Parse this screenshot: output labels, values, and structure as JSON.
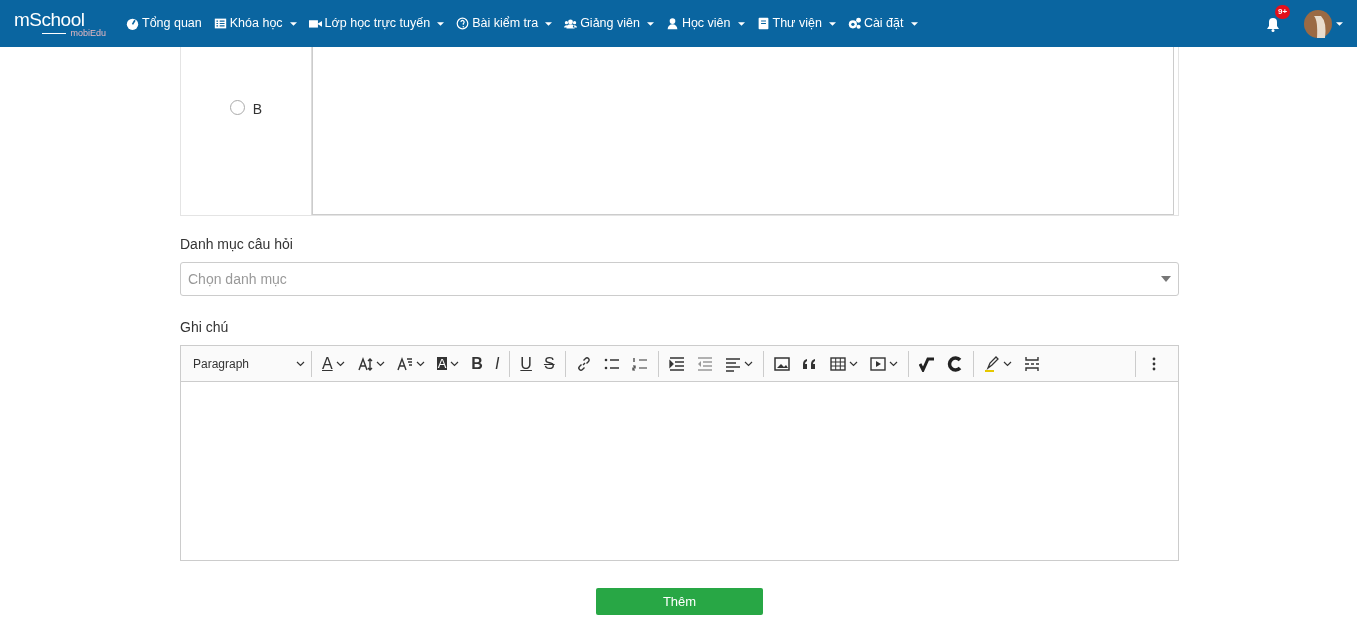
{
  "navbar": {
    "logo": {
      "main": "mSchool",
      "sub": "mobiEdu"
    },
    "items": [
      {
        "kind": "gauge",
        "label": "Tổng quan",
        "dropdown": false
      },
      {
        "kind": "list",
        "label": "Khóa học",
        "dropdown": true
      },
      {
        "kind": "video",
        "label": "Lớp học trực tuyến",
        "dropdown": true
      },
      {
        "kind": "question",
        "label": "Bài kiểm tra",
        "dropdown": true
      },
      {
        "kind": "users",
        "label": "Giảng viên",
        "dropdown": true
      },
      {
        "kind": "user",
        "label": "Học viên",
        "dropdown": true
      },
      {
        "kind": "book",
        "label": "Thư viện",
        "dropdown": true
      },
      {
        "kind": "gears",
        "label": "Cài đặt",
        "dropdown": true
      }
    ],
    "notifications": {
      "badge": "9+"
    }
  },
  "answer": {
    "label": "B",
    "selected": false
  },
  "category": {
    "label": "Danh mục câu hỏi",
    "placeholder": "Chọn danh mục"
  },
  "note": {
    "label": "Ghi chú",
    "heading_select": "Paragraph",
    "toolbar": [
      [
        {
          "kind": "font-color",
          "glyph": "A",
          "dropdown": true
        },
        {
          "kind": "font-size",
          "dropdown": true
        },
        {
          "kind": "font-family",
          "dropdown": true
        },
        {
          "kind": "bg-color",
          "glyph": "A",
          "dropdown": true
        },
        {
          "kind": "bold",
          "glyph": "B",
          "dropdown": false
        },
        {
          "kind": "italic",
          "glyph": "I",
          "dropdown": false
        }
      ],
      [
        {
          "kind": "underline",
          "glyph": "U",
          "dropdown": false
        },
        {
          "kind": "strike",
          "glyph": "S",
          "dropdown": false
        }
      ],
      [
        {
          "kind": "link",
          "dropdown": false
        },
        {
          "kind": "bullets",
          "dropdown": false
        },
        {
          "kind": "numbers",
          "dropdown": false
        }
      ],
      [
        {
          "kind": "indent",
          "dropdown": false
        },
        {
          "kind": "outdent",
          "dropdown": false
        },
        {
          "kind": "align",
          "dropdown": true
        }
      ],
      [
        {
          "kind": "image",
          "dropdown": false
        },
        {
          "kind": "quote",
          "dropdown": false
        },
        {
          "kind": "table",
          "dropdown": true
        },
        {
          "kind": "media",
          "dropdown": true
        }
      ],
      [
        {
          "kind": "math",
          "dropdown": false
        },
        {
          "kind": "chem",
          "dropdown": false
        }
      ],
      [
        {
          "kind": "highlight",
          "dropdown": true
        },
        {
          "kind": "page-break",
          "dropdown": false
        }
      ],
      [
        {
          "kind": "more",
          "dropdown": false
        }
      ]
    ]
  },
  "submit": {
    "label": "Thêm"
  }
}
